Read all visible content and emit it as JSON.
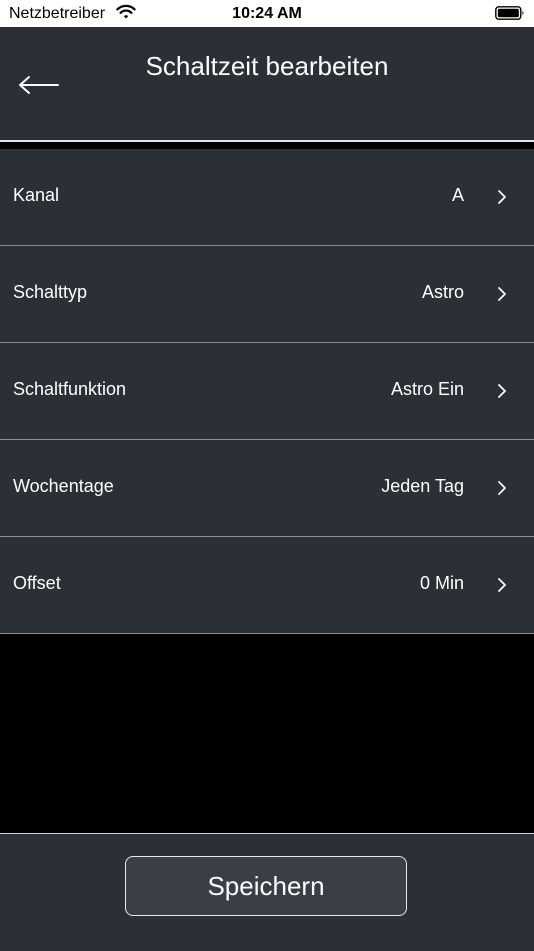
{
  "status_bar": {
    "carrier": "Netzbetreiber",
    "time": "10:24 AM",
    "wifi_icon": "wifi-icon",
    "battery_icon": "battery-icon"
  },
  "header": {
    "title": "Schaltzeit bearbeiten",
    "back_icon": "arrow-left-icon",
    "background": "#2b2f36"
  },
  "settings": [
    {
      "label": "Kanal",
      "value": "A"
    },
    {
      "label": "Schalttyp",
      "value": "Astro"
    },
    {
      "label": "Schaltfunktion",
      "value": "Astro Ein"
    },
    {
      "label": "Wochentage",
      "value": "Jeden Tag"
    },
    {
      "label": "Offset",
      "value": "0 Min"
    }
  ],
  "footer": {
    "save_label": "Speichern"
  },
  "colors": {
    "panel": "#2b2f36",
    "background": "#000000",
    "button": "#3a3f47",
    "text": "#ffffff"
  }
}
